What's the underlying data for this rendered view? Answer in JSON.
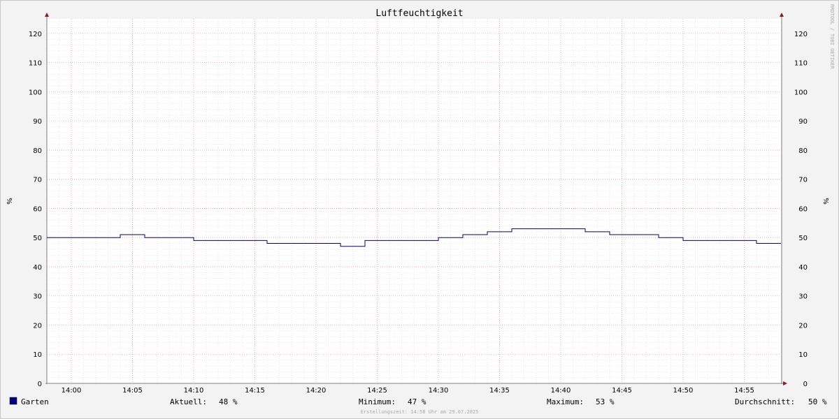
{
  "chart_data": {
    "type": "line",
    "title": "Luftfeuchtigkeit",
    "ylabel": "%",
    "ylabel_right": "%",
    "ylim": [
      0,
      125
    ],
    "yticks": [
      0,
      10,
      20,
      30,
      40,
      50,
      60,
      70,
      80,
      90,
      100,
      110,
      120
    ],
    "xlim": [
      "13:58",
      "14:58"
    ],
    "xticks": [
      "14:00",
      "14:05",
      "14:10",
      "14:15",
      "14:20",
      "14:25",
      "14:30",
      "14:35",
      "14:40",
      "14:45",
      "14:50",
      "14:55"
    ],
    "grid": true,
    "series": [
      {
        "name": "Garten",
        "color": "#000080",
        "step": true,
        "x": [
          "13:58",
          "14:04",
          "14:06",
          "14:10",
          "14:16",
          "14:22",
          "14:24",
          "14:30",
          "14:32",
          "14:34",
          "14:36",
          "14:42",
          "14:44",
          "14:48",
          "14:50",
          "14:56"
        ],
        "values": [
          50,
          51,
          50,
          49,
          48,
          47,
          49,
          50,
          51,
          52,
          53,
          52,
          51,
          50,
          49,
          48
        ]
      }
    ],
    "legend": {
      "position": "bottom",
      "series_label": "Garten",
      "stats": [
        {
          "label": "Aktuell:",
          "value": "48 %"
        },
        {
          "label": "Minimum:",
          "value": "47 %"
        },
        {
          "label": "Maximum:",
          "value": "53 %"
        },
        {
          "label": "Durchschnitt:",
          "value": "50 %"
        }
      ]
    },
    "watermark": "RRDTOOL / TOBI OETIKER",
    "footer": "Erstellungszeit: 14:58 Uhr am 29.07.2025"
  },
  "colors": {
    "background": "#f3f3f3",
    "plot_background": "#ffffff",
    "grid_minor": "#dcdcdc",
    "grid_major": "#f0a0a0",
    "axis": "#808080",
    "line": "#000080",
    "arrow": "#8b1a1a"
  }
}
